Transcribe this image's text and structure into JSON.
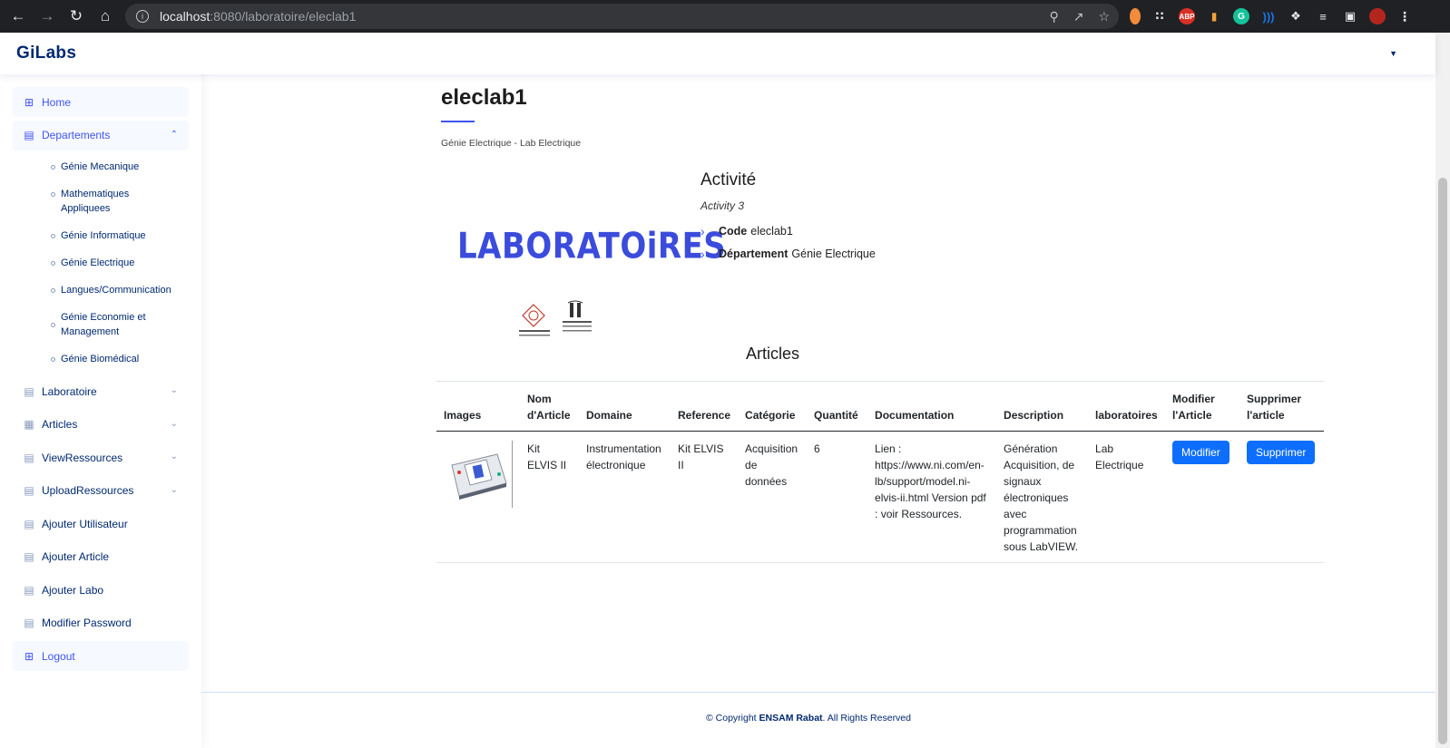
{
  "browser": {
    "url_host": "localhost",
    "url_path": ":8080/laboratoire/eleclab1"
  },
  "header": {
    "logo": "GiLabs"
  },
  "sidebar": {
    "home": "Home",
    "departements": "Departements",
    "sub_items": [
      "Génie Mecanique",
      "Mathematiques Appliquees",
      "Génie Informatique",
      "Génie Electrique",
      "Langues/Communication",
      "Génie Economie et Management",
      "Génie Biomédical"
    ],
    "laboratoire": "Laboratoire",
    "articles": "Articles",
    "view_ressources": "ViewRessources",
    "upload_ressources": "UploadRessources",
    "ajouter_utilisateur": "Ajouter Utilisateur",
    "ajouter_article": "Ajouter Article",
    "ajouter_labo": "Ajouter Labo",
    "modifier_password": "Modifier Password",
    "logout": "Logout"
  },
  "page": {
    "title": "eleclab1",
    "subtitle": "Génie Electrique - Lab Electrique",
    "lab_image_text": "LABORATOiRES",
    "activity_title": "Activité",
    "activity_value": "Activity 3",
    "code_label": "Code",
    "code_value": "eleclab1",
    "dept_label": "Département",
    "dept_value": "Génie Electrique",
    "articles_title": "Articles"
  },
  "table": {
    "headers": {
      "images": "Images",
      "nom": "Nom d'Article",
      "domaine": "Domaine",
      "reference": "Reference",
      "categorie": "Catégorie",
      "quantite": "Quantité",
      "documentation": "Documentation",
      "description": "Description",
      "laboratoires": "laboratoires",
      "modifier": "Modifier l'Article",
      "supprimer": "Supprimer l'article"
    },
    "rows": [
      {
        "nom": "Kit ELVIS II",
        "domaine": "Instrumentation électronique",
        "reference": "Kit ELVIS II",
        "categorie": "Acquisition de données",
        "quantite": "6",
        "documentation": "Lien : https://www.ni.com/en-lb/support/model.ni-elvis-ii.html Version pdf : voir Ressources.",
        "description": "Génération Acquisition, de signaux électroniques avec programmation sous LabVIEW.",
        "laboratoire": "Lab Electrique",
        "modifier_label": "Modifier",
        "supprimer_label": "Supprimer"
      }
    ]
  },
  "footer": {
    "prefix": "© Copyright",
    "brand": "ENSAM Rabat",
    "suffix": ". All Rights Reserved"
  },
  "colors": {
    "accent": "#4154f1",
    "nav_text": "#012970",
    "button": "#0d6efd"
  }
}
